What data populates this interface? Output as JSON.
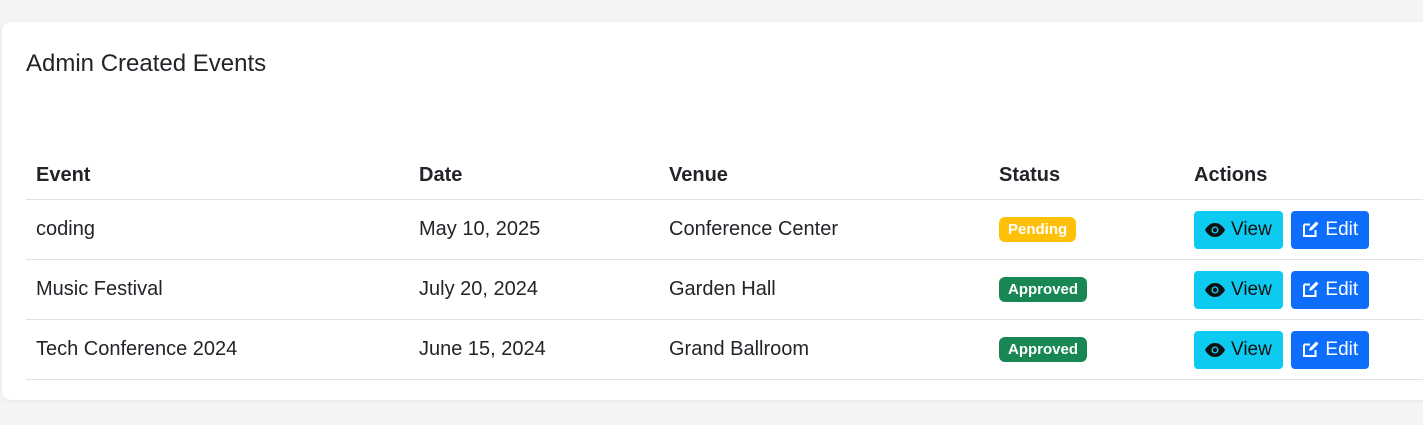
{
  "card": {
    "title": "Admin Created Events"
  },
  "table": {
    "headers": [
      "Event",
      "Date",
      "Venue",
      "Status",
      "Actions"
    ],
    "rows": [
      {
        "event": "coding",
        "date": "May 10, 2025",
        "venue": "Conference Center",
        "status": "Pending"
      },
      {
        "event": "Music Festival",
        "date": "July 20, 2024",
        "venue": "Garden Hall",
        "status": "Approved"
      },
      {
        "event": "Tech Conference 2024",
        "date": "June 15, 2024",
        "venue": "Grand Ballroom",
        "status": "Approved"
      }
    ]
  },
  "actions": {
    "view_label": "View",
    "edit_label": "Edit",
    "view_icon": "eye-icon",
    "edit_icon": "edit-icon"
  },
  "colors": {
    "pending": "#ffc107",
    "approved": "#198754",
    "view_button": "#0dcaf0",
    "edit_button": "#0d6efd"
  }
}
